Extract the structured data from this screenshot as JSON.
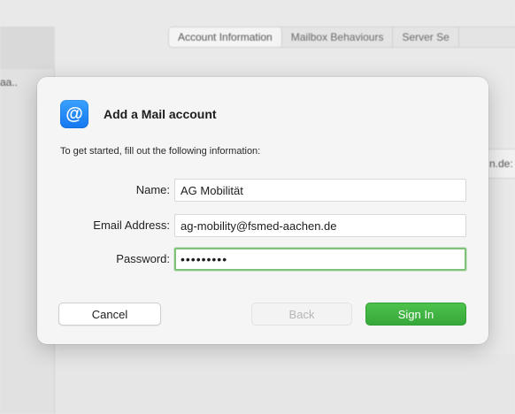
{
  "background": {
    "left_pane_text": "aa..",
    "tabs": [
      {
        "label": "Account Information",
        "active": true
      },
      {
        "label": "Mailbox Behaviours",
        "active": false
      },
      {
        "label": "Server Se",
        "active": false
      }
    ],
    "right_field_text": "n.de:"
  },
  "dialog": {
    "icon": "mail-at-icon",
    "icon_glyph": "@",
    "title": "Add a Mail account",
    "subtitle": "To get started, fill out the following information:",
    "fields": {
      "name": {
        "label": "Name:",
        "value": "AG Mobilität"
      },
      "email": {
        "label": "Email Address:",
        "value": "ag-mobility@fsmed-aachen.de"
      },
      "password": {
        "label": "Password:",
        "value": "•••••••••"
      }
    },
    "buttons": {
      "cancel": "Cancel",
      "back": "Back",
      "sign_in": "Sign In"
    }
  },
  "colors": {
    "accent_green": "#36a83a",
    "focus_ring": "#7fc37a",
    "icon_blue": "#1477f0"
  }
}
